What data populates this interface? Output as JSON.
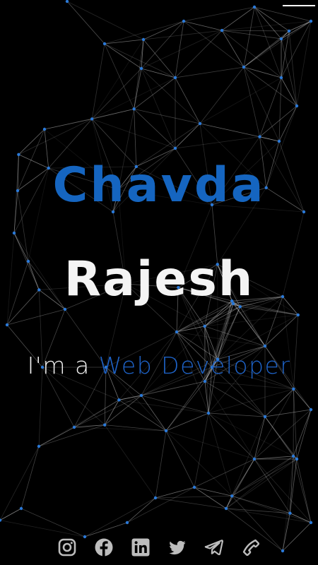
{
  "hero": {
    "first_name": "Chavda",
    "last_name": "Rajesh",
    "tagline_prefix": "I'm a ",
    "tagline_role": "Web Developer"
  },
  "nav": {
    "menu_icon": "hamburger-menu-icon"
  },
  "social_links": [
    {
      "icon": "instagram-icon"
    },
    {
      "icon": "facebook-icon"
    },
    {
      "icon": "linkedin-icon"
    },
    {
      "icon": "twitter-icon"
    },
    {
      "icon": "telegram-icon"
    },
    {
      "icon": "phone-icon"
    }
  ],
  "colors": {
    "background": "#000000",
    "accent": "#1565c0",
    "text": "#f4f4f4",
    "node": "#2a79d8",
    "line": "#ffffff",
    "icon": "#bdbdbd"
  }
}
